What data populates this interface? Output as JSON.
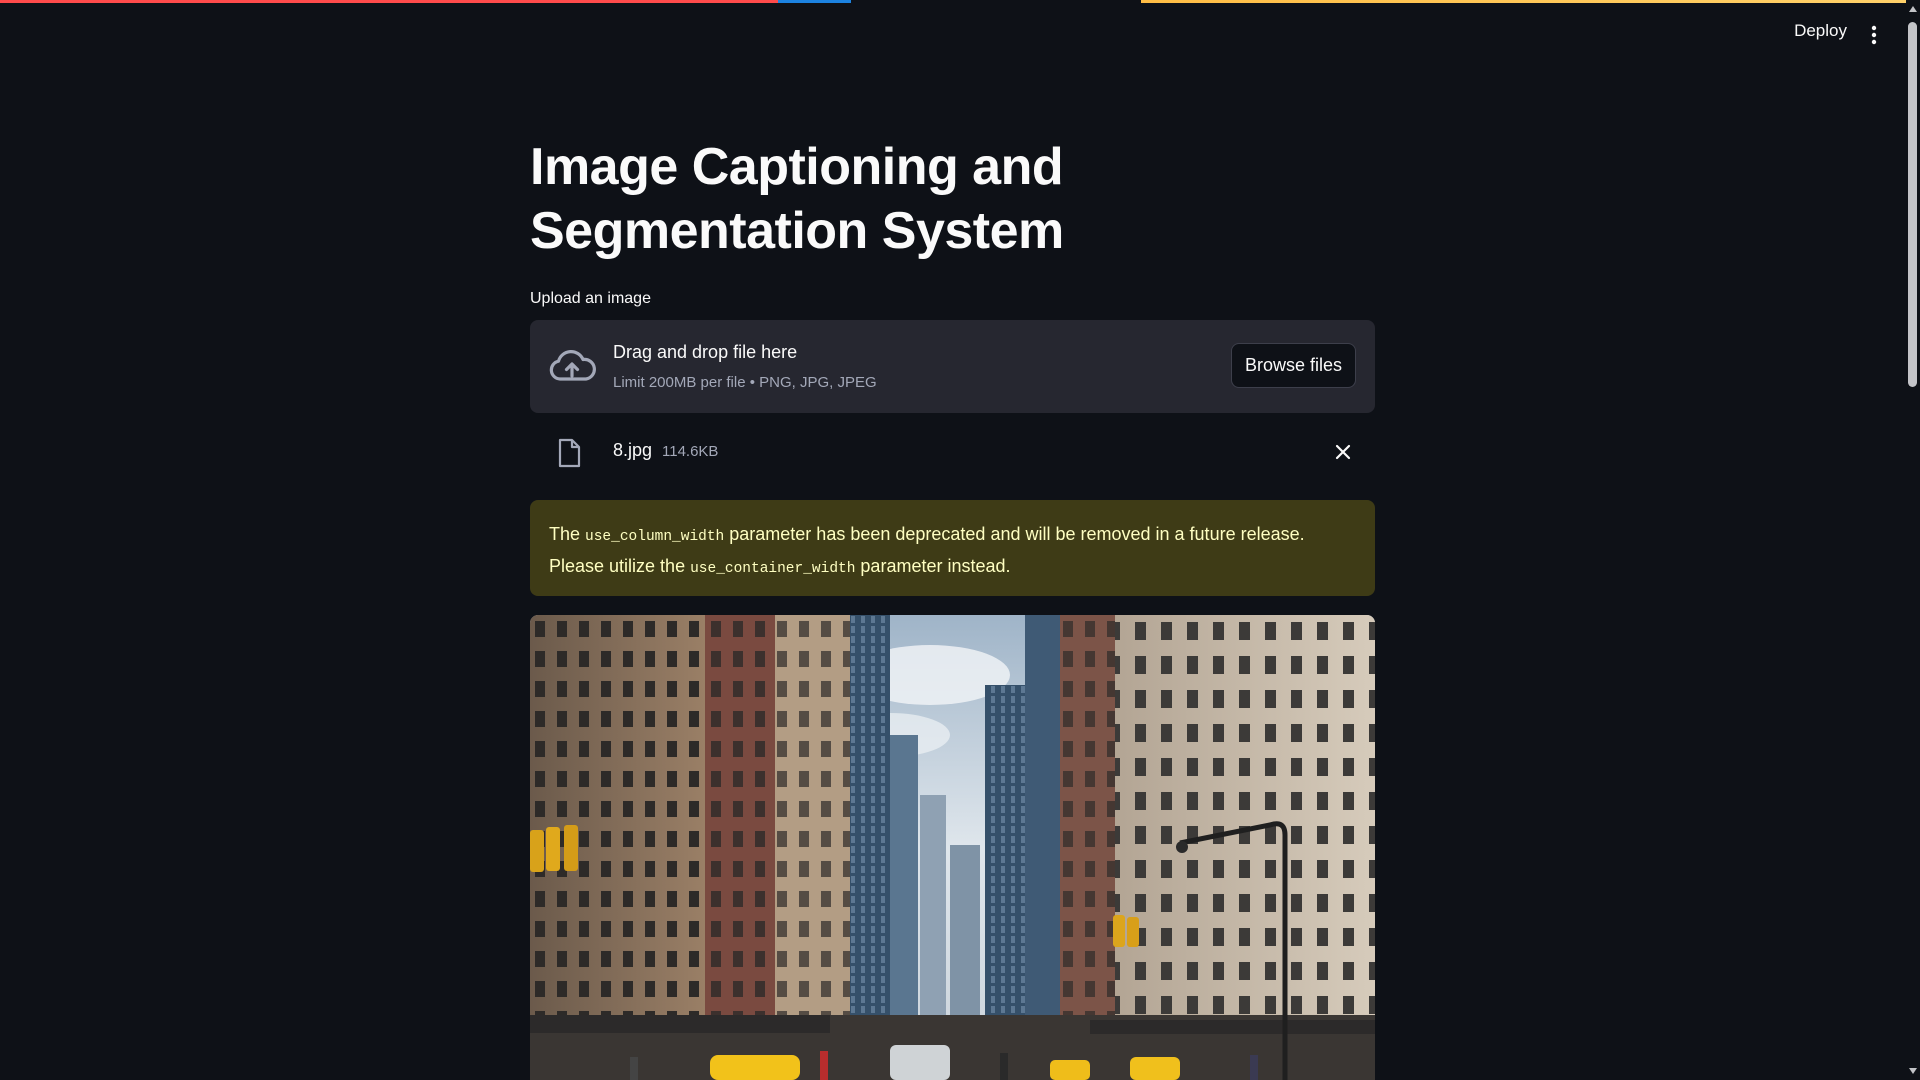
{
  "header": {
    "deploy_label": "Deploy",
    "menu_icon": "kebab-menu-icon",
    "decoration_colors": [
      "#ff4b4b",
      "#1c83e1",
      "#0e1117",
      "#ffbd45"
    ]
  },
  "main": {
    "title": "Image Captioning and Segmentation System",
    "uploader": {
      "label": "Upload an image",
      "drop_text": "Drag and drop file here",
      "limit_text": "Limit 200MB per file • PNG, JPG, JPEG",
      "browse_label": "Browse files",
      "upload_icon": "cloud-upload-icon"
    },
    "uploaded_file": {
      "name": "8.jpg",
      "size": "114.6KB",
      "file_icon": "file-icon",
      "remove_icon": "close-icon"
    },
    "warning": {
      "part1": "The ",
      "code1": "use_column_width",
      "part2": " parameter has been deprecated and will be removed in a future release. Please utilize the ",
      "code2": "use_container_width",
      "part3": " parameter instead."
    },
    "image": {
      "alt": "8.jpg"
    }
  },
  "colors": {
    "background": "#0e1117",
    "dropzone": "#262730",
    "warning_bg": "#3e3b16",
    "warning_text": "#ffffc2",
    "muted_text": "#a3a8b8"
  }
}
